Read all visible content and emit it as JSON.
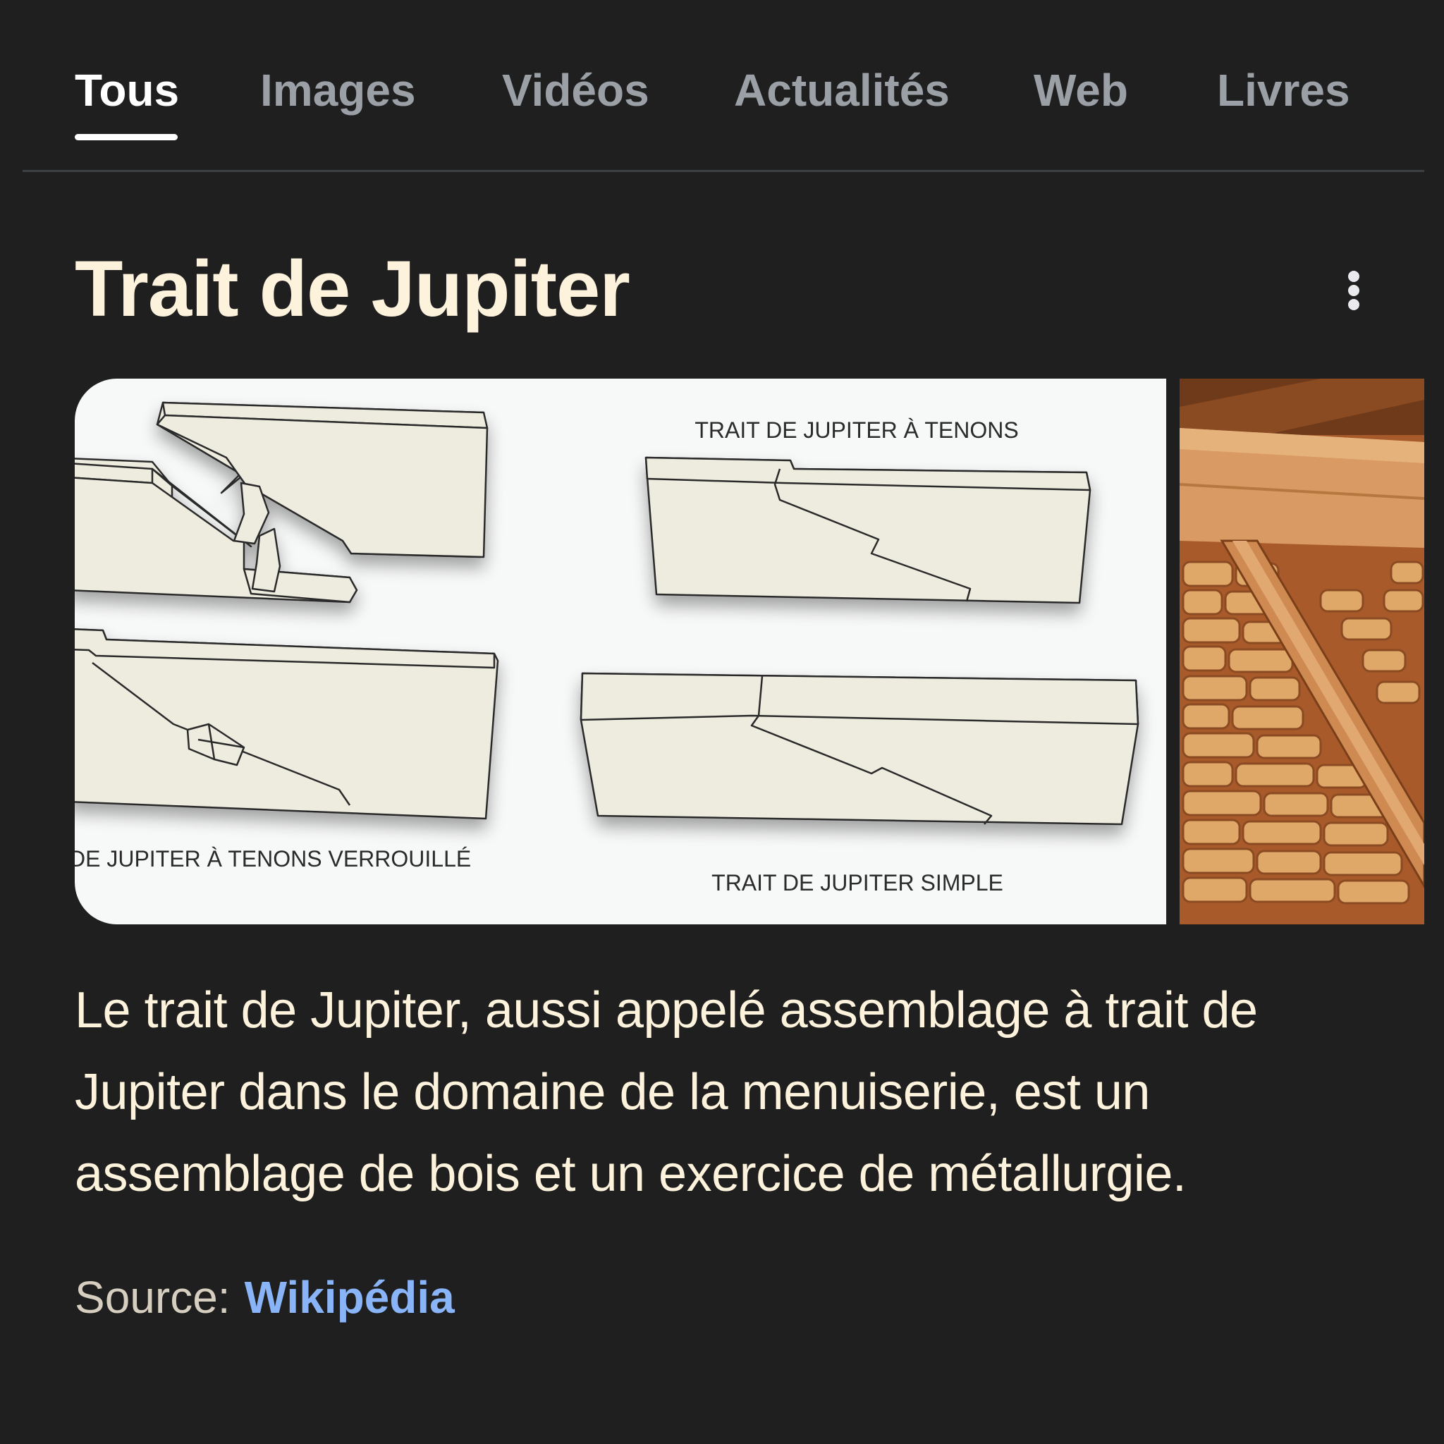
{
  "tabs": [
    {
      "label": "Tous",
      "active": true
    },
    {
      "label": "Images",
      "active": false
    },
    {
      "label": "Vidéos",
      "active": false
    },
    {
      "label": "Actualités",
      "active": false
    },
    {
      "label": "Web",
      "active": false
    },
    {
      "label": "Livres",
      "active": false
    }
  ],
  "panel": {
    "title": "Trait de Jupiter",
    "menu_icon": "more-vert-icon",
    "images": {
      "diagram_labels": {
        "tenons": "TRAIT DE JUPITER À TENONS",
        "tenons_verrouille": "DE JUPITER À TENONS VERROUILLÉ",
        "simple": "TRAIT DE JUPITER SIMPLE"
      }
    },
    "description": "Le trait de Jupiter, aussi appelé assemblage à trait de Jupiter dans le domaine de la menuiserie, est un assemblage de bois et un exercice de métallurgie.",
    "source_label": "Source:",
    "source_link": "Wikipédia"
  },
  "colors": {
    "background": "#1f1f1f",
    "text_primary": "#fdf3dd",
    "tab_inactive": "#9aa0a6",
    "link": "#8ab4f8",
    "wood_beam": "#eeebdf"
  }
}
